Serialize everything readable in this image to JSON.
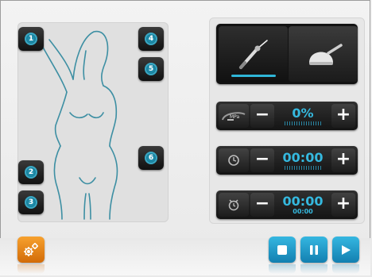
{
  "body_panel": {
    "zones": [
      {
        "label": "1"
      },
      {
        "label": "2"
      },
      {
        "label": "3"
      },
      {
        "label": "4"
      },
      {
        "label": "5"
      },
      {
        "label": "6"
      }
    ]
  },
  "handpieces": {
    "selected": "needle-handpiece",
    "items": [
      {
        "icon": "needle-handpiece-icon"
      },
      {
        "icon": "dome-handpiece-icon"
      }
    ]
  },
  "controls": {
    "intensity": {
      "icon": "mpa-gauge-icon",
      "value": "0%"
    },
    "duration": {
      "icon": "clock-icon",
      "value": "00:00"
    },
    "timer": {
      "icon": "alarm-clock-icon",
      "value": "00:00",
      "sub_value": "00:00"
    }
  },
  "colors": {
    "accent": "#35b9df",
    "settings": "#f08c1a",
    "panel": "#e0e0e0",
    "button": "#1a1a1a"
  },
  "footer": {
    "settings_icon": "gears-icon",
    "stop_icon": "stop-icon",
    "pause_icon": "pause-icon",
    "play_icon": "play-icon"
  }
}
